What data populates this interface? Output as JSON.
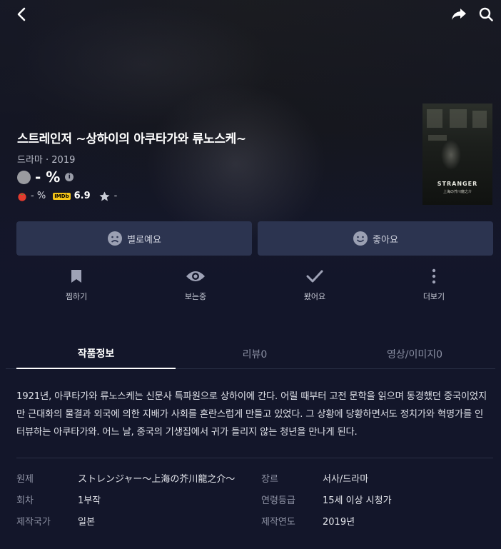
{
  "header": {
    "back_icon": "chevron-left-icon",
    "share_icon": "share-arrow-icon",
    "search_icon": "search-icon"
  },
  "movie": {
    "title": "스트레인저 ~상하이의 아쿠타가와 류노스케~",
    "meta": "드라마 · 2019",
    "score": "- %",
    "tomato_score": "- %",
    "imdb_label": "IMDb",
    "imdb_score": "6.9",
    "star_score": "-",
    "poster_title": "STRANGER",
    "poster_subtitle": "上海の芥川龍之介"
  },
  "evaluation": {
    "bad_label": "별로예요",
    "good_label": "좋아요"
  },
  "actions": [
    {
      "label": "찜하기",
      "icon": "bookmark-icon"
    },
    {
      "label": "보는중",
      "icon": "eye-icon"
    },
    {
      "label": "봤어요",
      "icon": "check-icon"
    },
    {
      "label": "더보기",
      "icon": "more-vertical-icon"
    }
  ],
  "tabs": [
    {
      "label": "작품정보",
      "active": true
    },
    {
      "label": "리뷰0",
      "active": false
    },
    {
      "label": "영상/이미지0",
      "active": false
    }
  ],
  "synopsis": "1921년, 아쿠타가와 류노스케는 신문사 특파원으로 상하이에 간다. 어릴 때부터 고전 문학을 읽으며 동경했던 중국이었지만 근대화의 물결과 외국에 의한 지배가 사회를 혼란스럽게 만들고 있었다. 그 상황에 당황하면서도 정치가와 혁명가를 인터뷰하는 아쿠타가와. 어느 날, 중국의 기생집에서 귀가 들리지 않는 청년을 만나게 된다.",
  "details": {
    "original_label": "원제",
    "original_value": "ストレンジャー～上海の芥川龍之介～",
    "genre_label": "장르",
    "genre_value": "서사/드라마",
    "episodes_label": "회차",
    "episodes_value": "1부작",
    "rating_label": "연령등급",
    "rating_value": "15세 이상 시청가",
    "country_label": "제작국가",
    "country_value": "일본",
    "year_label": "제작연도",
    "year_value": "2019년"
  },
  "colors": {
    "background": "#13162a",
    "button": "#2c3450",
    "imdb": "#f5c518",
    "tomato": "#e23b2e"
  }
}
